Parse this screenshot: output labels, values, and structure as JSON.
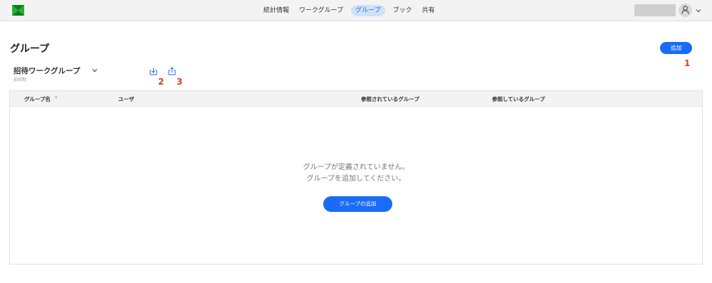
{
  "header": {
    "nav": [
      {
        "label": "統計情報"
      },
      {
        "label": "ワークグループ"
      },
      {
        "label": "グループ"
      },
      {
        "label": "ブック"
      },
      {
        "label": "共有"
      }
    ],
    "active_tab": "グループ"
  },
  "page": {
    "title": "グループ",
    "add_button": "追加"
  },
  "filter": {
    "selected": "招待ワークグループ",
    "sub_label": "招待制"
  },
  "callouts": {
    "one": "1",
    "two": "2",
    "three": "3"
  },
  "table": {
    "columns": [
      {
        "label": "グループ名"
      },
      {
        "label": "ユーザ"
      },
      {
        "label": "参照されているグループ"
      },
      {
        "label": "参照しているグループ"
      }
    ],
    "rows": [],
    "empty": {
      "line1": "グループが定義されていません。",
      "line2": "グループを追加してください。",
      "button": "グループの追加"
    }
  },
  "colors": {
    "accent": "#1a6bf5",
    "callout": "#e0401a",
    "logo": "#1fb32f"
  }
}
